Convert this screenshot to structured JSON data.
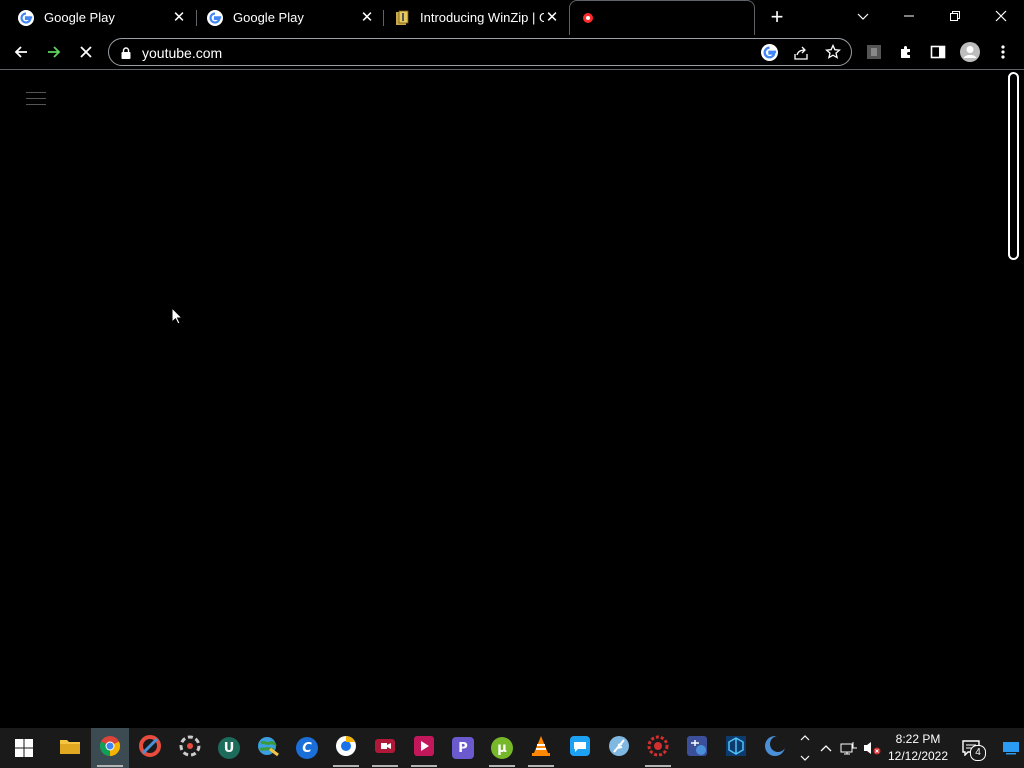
{
  "browser": {
    "tabs": [
      {
        "title": "Google Play",
        "favicon": "google-g-icon"
      },
      {
        "title": "Google Play",
        "favicon": "google-g-icon"
      },
      {
        "title": "Introducing WinZip | G",
        "favicon": "winzip-icon"
      },
      {
        "title": "",
        "favicon": "youtube-icon"
      }
    ],
    "active_tab_index": 3,
    "url": "youtube.com",
    "accent_color": "#5fd35f"
  },
  "taskbar": {
    "apps": [
      {
        "name": "file-explorer",
        "running": false
      },
      {
        "name": "google-chrome",
        "running": true
      },
      {
        "name": "ccleaner",
        "running": false
      },
      {
        "name": "aperture-app",
        "running": false
      },
      {
        "name": "uninstaller",
        "running": false
      },
      {
        "name": "globe-app",
        "running": false
      },
      {
        "name": "c-app",
        "running": false
      },
      {
        "name": "chromium-browser",
        "running": true
      },
      {
        "name": "screen-recorder",
        "running": true
      },
      {
        "name": "video-editor",
        "running": true
      },
      {
        "name": "p-app",
        "running": false
      },
      {
        "name": "utorrent",
        "running": true
      },
      {
        "name": "vlc",
        "running": true
      },
      {
        "name": "messenger",
        "running": false
      },
      {
        "name": "feather-app",
        "running": false
      },
      {
        "name": "red-gear-app",
        "running": true
      },
      {
        "name": "switch-app",
        "running": false
      },
      {
        "name": "cube-app",
        "running": false
      },
      {
        "name": "crescent-app",
        "running": false
      }
    ],
    "clock_time": "8:22 PM",
    "clock_date": "12/12/2022",
    "notification_count": "4"
  }
}
